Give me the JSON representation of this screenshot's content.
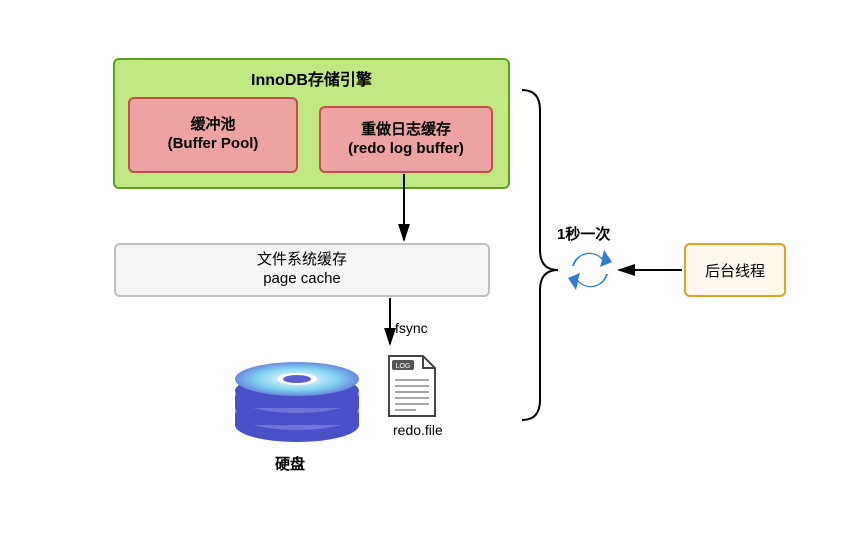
{
  "innodb": {
    "title": "InnoDB存储引擎",
    "buffer_pool_line1": "缓冲池",
    "buffer_pool_line2": "(Buffer Pool)",
    "redo_buf_line1": "重做日志缓存",
    "redo_buf_line2": "(redo log buffer)"
  },
  "page_cache": {
    "line1": "文件系统缓存",
    "line2": "page cache"
  },
  "fsync_label": "fsync",
  "interval_label": "1秒一次",
  "bg_thread_label": "后台线程",
  "disk_label": "硬盘",
  "redo_file_label": "redo.file",
  "file_icon_tag": "LOG"
}
